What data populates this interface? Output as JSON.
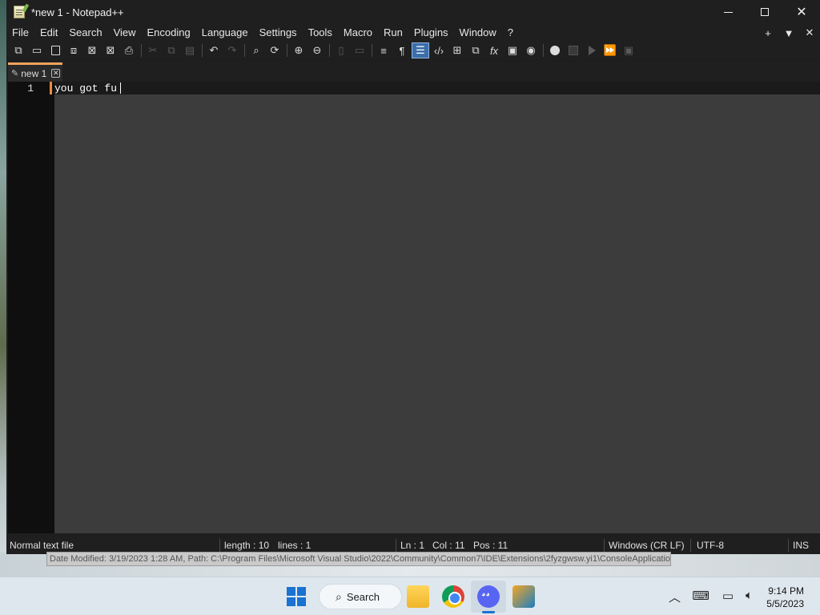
{
  "window": {
    "title": "*new 1 - Notepad++",
    "controls": {
      "minimize": "—",
      "maximize": "□",
      "close": "✕"
    }
  },
  "menu": {
    "items": [
      "File",
      "Edit",
      "Search",
      "View",
      "Encoding",
      "Language",
      "Settings",
      "Tools",
      "Macro",
      "Run",
      "Plugins",
      "Window",
      "?"
    ],
    "right": {
      "add": "+",
      "dropdown": "▼",
      "close": "✕"
    }
  },
  "toolbar": {
    "icons": [
      "new-file-icon",
      "open-file-icon",
      "save-icon",
      "save-all-icon",
      "close-icon",
      "close-all-icon",
      "print-icon",
      "cut-icon",
      "copy-icon",
      "paste-icon",
      "undo-icon",
      "redo-icon",
      "find-icon",
      "replace-icon",
      "zoom-in-icon",
      "zoom-out-icon",
      "sync-vertical-icon",
      "sync-horizontal-icon",
      "word-wrap-icon",
      "show-all-chars-icon",
      "indent-guide-icon",
      "xml-tag-icon",
      "document-map-icon",
      "document-list-icon",
      "function-list-icon",
      "folder-as-workspace-icon",
      "monitoring-icon",
      "record-macro-icon",
      "stop-recording-icon",
      "playback-icon",
      "run-macro-multiple-icon",
      "save-macro-icon"
    ]
  },
  "tabs": [
    {
      "label": "new 1",
      "modified": true
    }
  ],
  "editor": {
    "lines": [
      {
        "number": "1",
        "text": "you got fu"
      }
    ]
  },
  "status": {
    "language": "Normal text file",
    "length": "length : 10",
    "lines": "lines : 1",
    "ln": "Ln : 1",
    "col": "Col : 11",
    "pos": "Pos : 11",
    "eol": "Windows (CR LF)",
    "encoding": "UTF-8",
    "mode": "INS"
  },
  "tooltip": "Date Modified: 3/19/2023 1:28 AM, Path: C:\\Program Files\\Microsoft Visual Studio\\2022\\Community\\Common7\\IDE\\Extensions\\2fyzgwsw.yi1\\ConsoleApplicatio",
  "taskbar": {
    "search_label": "Search",
    "time": "9:14 PM",
    "date": "5/5/2023"
  }
}
